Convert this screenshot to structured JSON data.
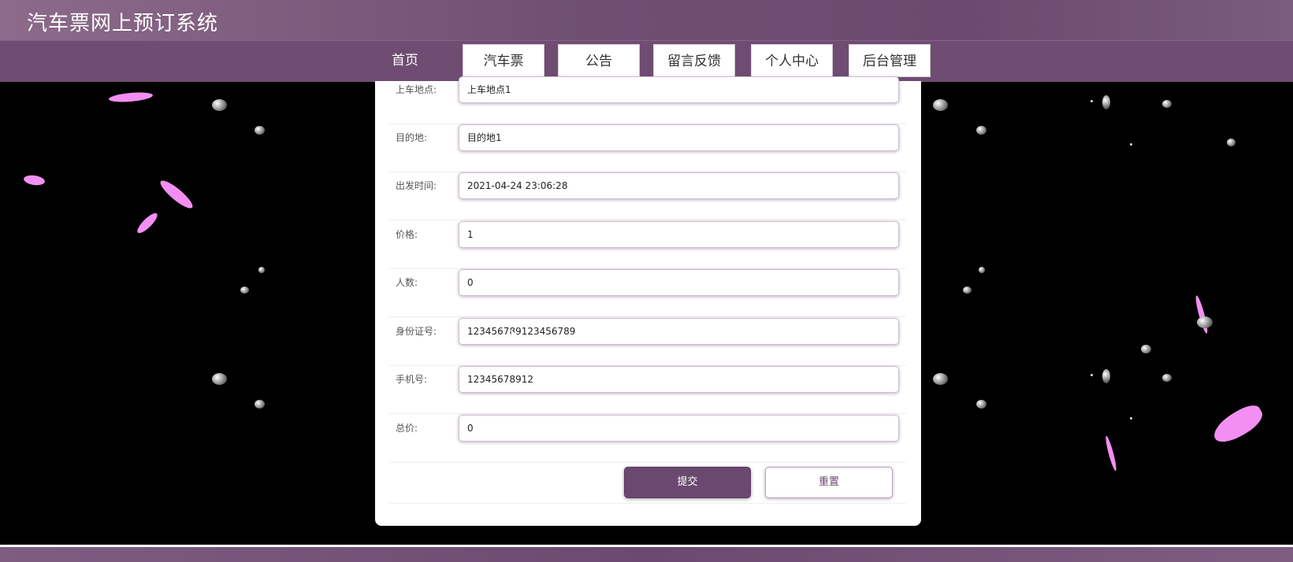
{
  "header": {
    "title": "汽车票网上预订系统"
  },
  "nav": [
    {
      "label": "首页"
    },
    {
      "label": "汽车票"
    },
    {
      "label": "公告"
    },
    {
      "label": "留言反馈"
    },
    {
      "label": "个人中心"
    },
    {
      "label": "后台管理"
    }
  ],
  "form": {
    "fields": [
      {
        "label": "上车地点:",
        "value": "上车地点1"
      },
      {
        "label": "目的地:",
        "value": "目的地1"
      },
      {
        "label": "出发时间:",
        "value": "2021-04-24 23:06:28"
      },
      {
        "label": "价格:",
        "value": "1"
      },
      {
        "label": "人数:",
        "value": "0"
      },
      {
        "label": "身份证号:",
        "value": "123456789123456789"
      },
      {
        "label": "手机号:",
        "value": "12345678912"
      },
      {
        "label": "总价:",
        "value": "0"
      }
    ],
    "submit_label": "提交",
    "reset_label": "重置"
  },
  "colors": {
    "accent": "#6b4870",
    "nav_bg": "#6f4c72",
    "petal": "#f38ff2"
  }
}
